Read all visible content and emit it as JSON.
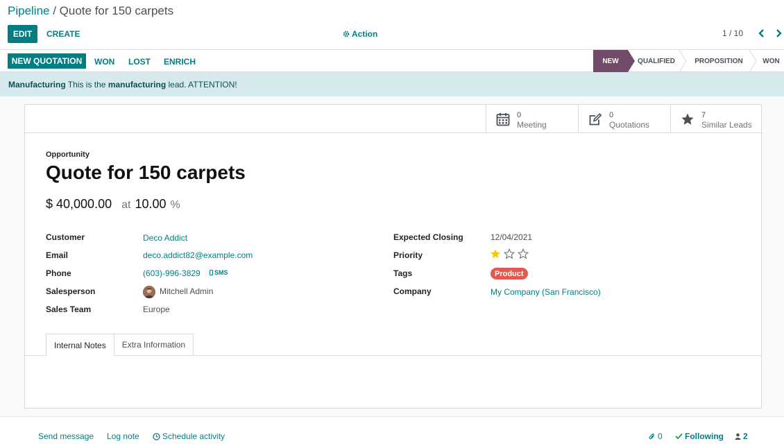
{
  "breadcrumb": {
    "parent": "Pipeline",
    "separator": " / ",
    "current": "Quote for 150 carpets"
  },
  "toolbar": {
    "edit": "EDIT",
    "create": "CREATE",
    "action": "Action",
    "pager": "1 / 10"
  },
  "statusbar": {
    "buttons": {
      "new_quotation": "NEW QUOTATION",
      "won": "WON",
      "lost": "LOST",
      "enrich": "ENRICH"
    },
    "stages": {
      "new": "NEW",
      "qualified": "QUALIFIED",
      "proposition": "PROPOSITION",
      "won": "WON"
    },
    "active_stage": "NEW"
  },
  "alert": {
    "prefix": "Manufacturing",
    "text1": " This is the ",
    "keyword": "manufacturing",
    "text2": " lead. ATTENTION!"
  },
  "smart_buttons": {
    "meeting": {
      "count": "0",
      "label": "Meeting"
    },
    "quotations": {
      "count": "0",
      "label": "Quotations"
    },
    "similar": {
      "count": "7",
      "label": "Similar Leads"
    }
  },
  "lead": {
    "type_label": "Opportunity",
    "name": "Quote for 150 carpets",
    "revenue": "$ 40,000.00",
    "at": "at",
    "probability": "10.00",
    "pct": "%"
  },
  "fields": {
    "customer": {
      "label": "Customer",
      "value": "Deco Addict"
    },
    "email": {
      "label": "Email",
      "value": "deco.addict82@example.com"
    },
    "phone": {
      "label": "Phone",
      "value": "(603)-996-3829",
      "sms": "SMS"
    },
    "salesperson": {
      "label": "Salesperson",
      "value": "Mitchell Admin"
    },
    "sales_team": {
      "label": "Sales Team",
      "value": "Europe"
    },
    "expected_closing": {
      "label": "Expected Closing",
      "value": "12/04/2021"
    },
    "priority": {
      "label": "Priority",
      "stars_filled": 1,
      "stars_total": 3
    },
    "tags": {
      "label": "Tags",
      "value": "Product"
    },
    "company": {
      "label": "Company",
      "value": "My Company (San Francisco)"
    }
  },
  "tabs": {
    "internal_notes": "Internal Notes",
    "extra_info": "Extra Information"
  },
  "chatter": {
    "send_message": "Send message",
    "log_note": "Log note",
    "schedule_activity": "Schedule activity",
    "attachments": "0",
    "following": "Following",
    "followers": "2"
  },
  "colors": {
    "accent": "#017e84",
    "stage_active": "#714b67",
    "tag": "#e05a4f",
    "alert_bg": "#d6eaed",
    "star": "#f3cc00"
  }
}
